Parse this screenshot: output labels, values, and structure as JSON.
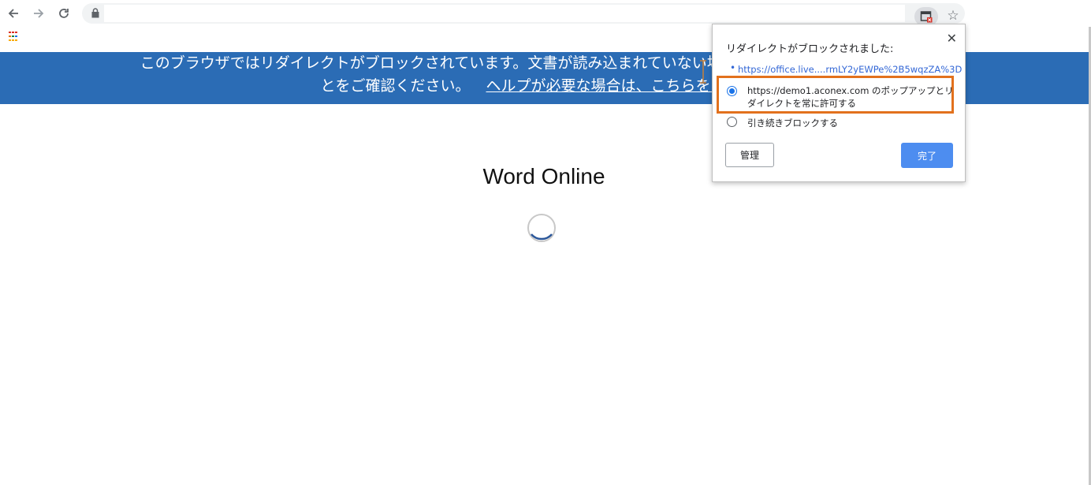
{
  "toolbar": {
    "back_icon": "arrow-left-icon",
    "forward_icon": "arrow-right-icon",
    "reload_icon": "reload-icon",
    "lock_icon": "lock-icon",
    "blocked_icon": "popup-blocked-icon",
    "star_icon": "star-icon"
  },
  "banner": {
    "line1": "このブラウザではリダイレクトがブロックされています。文書が読み込まれていない場合は、ブラウザ                                        許可されているこ",
    "line2_text": "とをご確認ください。",
    "line2_link": "ヘルプが必要な場合は、こちらをクリック"
  },
  "main": {
    "title": "Word Online"
  },
  "popup": {
    "title": "リダイレクトがブロックされました:",
    "close": "✕",
    "blocked_url": "https://office.live....rmLY2yEWPe%2B5wqzZA%3D",
    "option_allow": "https://demo1.aconex.com のポップアップとリダイレクトを常に許可する",
    "option_block": "引き続きブロックする",
    "manage_label": "管理",
    "done_label": "完了"
  },
  "colors": {
    "banner_bg": "#2b6cb5",
    "highlight": "#e2711d",
    "done_button": "#4d8df0",
    "link": "#3367d6"
  }
}
